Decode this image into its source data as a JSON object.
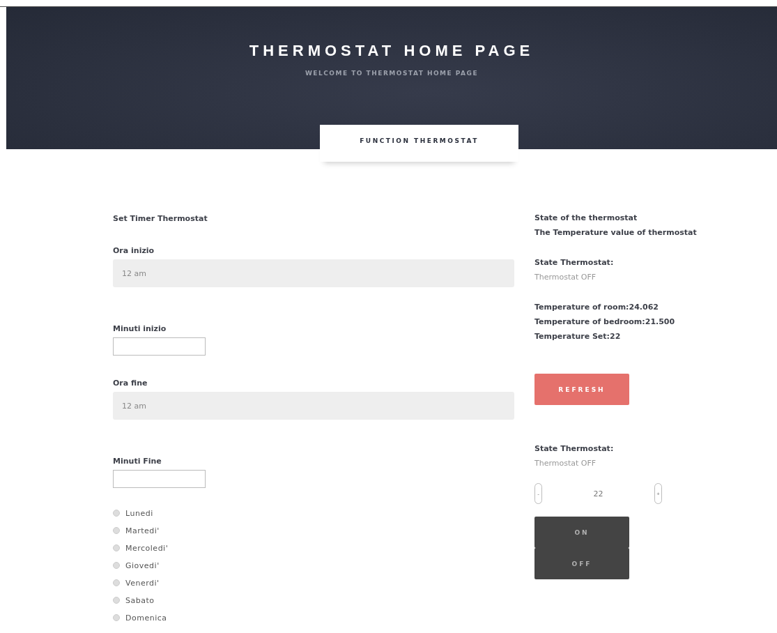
{
  "header": {
    "title": "THERMOSTAT HOME PAGE",
    "subtitle": "WELCOME TO THERMOSTAT HOME PAGE"
  },
  "tabs": [
    {
      "label": "FUNCTION THERMOSTAT",
      "selected": true
    }
  ],
  "timer": {
    "title": "Set Timer Thermostat",
    "fields": [
      {
        "kind": "select",
        "label": "Ora inizio",
        "value": "12 am"
      },
      {
        "kind": "input",
        "label": "Minuti inizio"
      },
      {
        "kind": "select",
        "label": "Ora fine",
        "value": "12 am"
      },
      {
        "kind": "input",
        "label": "Minuti Fine"
      }
    ],
    "days": [
      {
        "label": "Lunedi",
        "checked": false
      },
      {
        "label": "Martedi'",
        "checked": false
      },
      {
        "label": "Mercoledi'",
        "checked": false
      },
      {
        "label": "Giovedi'",
        "checked": false
      },
      {
        "label": "Venerdi'",
        "checked": false
      },
      {
        "label": "Sabato",
        "checked": false
      },
      {
        "label": "Domenica",
        "checked": false
      }
    ]
  },
  "status": {
    "heading_1": "State of the thermostat",
    "heading_2": "The Temperature value of thermostat",
    "state_label": "State Thermostat:",
    "state_value": "Thermostat OFF",
    "readings": [
      "Temperature of room:24.062",
      "Temperature of bedroom:21.500",
      "Temperature Set:22"
    ],
    "refresh_button": "REFRESH"
  },
  "control": {
    "state_label": "State Thermostat:",
    "state_value": "Thermostat OFF",
    "minus": "-",
    "value": "22",
    "plus": "+",
    "on_button": "ON",
    "off_button": "OFF"
  }
}
